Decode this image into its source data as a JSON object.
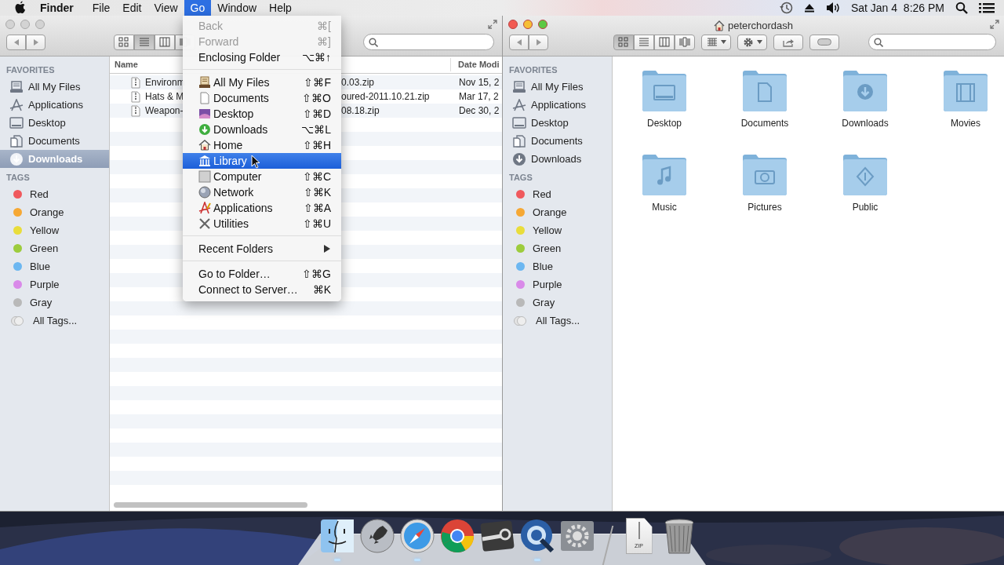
{
  "menu_bar": {
    "items": [
      {
        "label": "Finder",
        "kind": "app",
        "selected": false
      },
      {
        "label": "File",
        "kind": "menu",
        "selected": false
      },
      {
        "label": "Edit",
        "kind": "menu",
        "selected": false
      },
      {
        "label": "View",
        "kind": "menu",
        "selected": false
      },
      {
        "label": "Go",
        "kind": "menu",
        "selected": true
      },
      {
        "label": "Window",
        "kind": "menu",
        "selected": false
      },
      {
        "label": "Help",
        "kind": "menu",
        "selected": false
      }
    ],
    "clock": "Sat Jan 4  8:26 PM"
  },
  "go_menu": {
    "groups": [
      [
        {
          "label": "Back",
          "shortcut": "⌘[",
          "kind": "item",
          "disabled": true,
          "selected": false
        },
        {
          "label": "Forward",
          "shortcut": "⌘]",
          "kind": "item",
          "disabled": true,
          "selected": false
        },
        {
          "label": "Enclosing Folder",
          "shortcut": "⌥⌘↑",
          "kind": "item",
          "disabled": false,
          "selected": false
        }
      ],
      [
        {
          "label": "All My Files",
          "shortcut": "⇧⌘F",
          "kind": "files",
          "disabled": false,
          "selected": false
        },
        {
          "label": "Documents",
          "shortcut": "⇧⌘O",
          "kind": "documents",
          "disabled": false,
          "selected": false
        },
        {
          "label": "Desktop",
          "shortcut": "⇧⌘D",
          "kind": "desktop",
          "disabled": false,
          "selected": false
        },
        {
          "label": "Downloads",
          "shortcut": "⌥⌘L",
          "kind": "downloads",
          "disabled": false,
          "selected": false
        },
        {
          "label": "Home",
          "shortcut": "⇧⌘H",
          "kind": "home",
          "disabled": false,
          "selected": false
        },
        {
          "label": "Library",
          "kind": "library",
          "disabled": false,
          "selected": true
        },
        {
          "label": "Computer",
          "shortcut": "⇧⌘C",
          "kind": "computer",
          "disabled": false,
          "selected": false
        },
        {
          "label": "Network",
          "shortcut": "⇧⌘K",
          "kind": "network",
          "disabled": false,
          "selected": false
        },
        {
          "label": "Applications",
          "shortcut": "⇧⌘A",
          "kind": "applications",
          "disabled": false,
          "selected": false
        },
        {
          "label": "Utilities",
          "shortcut": "⇧⌘U",
          "kind": "utilities",
          "disabled": false,
          "selected": false
        }
      ],
      [
        {
          "label": "Recent Folders",
          "kind": "submenu",
          "disabled": false,
          "selected": false
        }
      ],
      [
        {
          "label": "Go to Folder…",
          "shortcut": "⇧⌘G",
          "kind": "item",
          "disabled": false,
          "selected": false
        },
        {
          "label": "Connect to Server…",
          "shortcut": "⌘K",
          "kind": "item",
          "disabled": false,
          "selected": false
        }
      ]
    ]
  },
  "left_window": {
    "active": false,
    "view_buttons": [
      {
        "kind": "icon",
        "selected": false
      },
      {
        "kind": "list",
        "selected": true
      },
      {
        "kind": "column",
        "selected": false
      },
      {
        "kind": "coverflow",
        "selected": false
      }
    ],
    "sidebar": {
      "sections": [
        {
          "heading": "FAVORITES",
          "items": [
            {
              "label": "All My Files",
              "kind": "files",
              "selected": false
            },
            {
              "label": "Applications",
              "kind": "applications",
              "selected": false
            },
            {
              "label": "Desktop",
              "kind": "desktop",
              "selected": false
            },
            {
              "label": "Documents",
              "kind": "documents",
              "selected": false
            },
            {
              "label": "Downloads",
              "kind": "downloads",
              "selected": true
            }
          ]
        },
        {
          "heading": "TAGS",
          "items": [
            {
              "label": "Red",
              "kind": "tag",
              "color": "#f0595d",
              "selected": false
            },
            {
              "label": "Orange",
              "kind": "tag",
              "color": "#f6a834",
              "selected": false
            },
            {
              "label": "Yellow",
              "kind": "tag",
              "color": "#e9dd3b",
              "selected": false
            },
            {
              "label": "Green",
              "kind": "tag",
              "color": "#9dcc3d",
              "selected": false
            },
            {
              "label": "Blue",
              "kind": "tag",
              "color": "#6cb7f1",
              "selected": false
            },
            {
              "label": "Purple",
              "kind": "tag",
              "color": "#d98ae9",
              "selected": false
            },
            {
              "label": "Gray",
              "kind": "tag",
              "color": "#b9b9b9",
              "selected": false
            },
            {
              "label": "All Tags...",
              "kind": "all",
              "selected": false
            }
          ]
        }
      ]
    },
    "file_list": {
      "columns": [
        "Name",
        "Date Modi"
      ],
      "rows": [
        {
          "name_start": "Environm",
          "name_end": "0.03.zip",
          "date": "Nov 15, 2"
        },
        {
          "name_start": "Hats & M",
          "name_end": "oured-2011.10.21.zip",
          "date": "Mar 17, 2"
        },
        {
          "name_start": "Weapon-",
          "name_end": "08.18.zip",
          "date": "Dec 30, 2"
        }
      ]
    }
  },
  "right_window": {
    "active": true,
    "title": "peterchordash",
    "view_buttons": [
      {
        "kind": "icon",
        "selected": true
      },
      {
        "kind": "list",
        "selected": false
      },
      {
        "kind": "column",
        "selected": false
      },
      {
        "kind": "coverflow",
        "selected": false
      }
    ],
    "sidebar": {
      "sections": [
        {
          "heading": "FAVORITES",
          "items": [
            {
              "label": "All My Files",
              "kind": "files",
              "selected": false
            },
            {
              "label": "Applications",
              "kind": "applications",
              "selected": false
            },
            {
              "label": "Desktop",
              "kind": "desktop",
              "selected": false
            },
            {
              "label": "Documents",
              "kind": "documents",
              "selected": false
            },
            {
              "label": "Downloads",
              "kind": "downloads",
              "selected": false
            }
          ]
        },
        {
          "heading": "TAGS",
          "items": [
            {
              "label": "Red",
              "kind": "tag",
              "color": "#f0595d",
              "selected": false
            },
            {
              "label": "Orange",
              "kind": "tag",
              "color": "#f6a834",
              "selected": false
            },
            {
              "label": "Yellow",
              "kind": "tag",
              "color": "#e9dd3b",
              "selected": false
            },
            {
              "label": "Green",
              "kind": "tag",
              "color": "#9dcc3d",
              "selected": false
            },
            {
              "label": "Blue",
              "kind": "tag",
              "color": "#6cb7f1",
              "selected": false
            },
            {
              "label": "Purple",
              "kind": "tag",
              "color": "#d98ae9",
              "selected": false
            },
            {
              "label": "Gray",
              "kind": "tag",
              "color": "#b9b9b9",
              "selected": false
            },
            {
              "label": "All Tags...",
              "kind": "all",
              "selected": false
            }
          ]
        }
      ]
    },
    "folders": [
      {
        "label": "Desktop",
        "kind": "desktop"
      },
      {
        "label": "Documents",
        "kind": "documents"
      },
      {
        "label": "Downloads",
        "kind": "downloads"
      },
      {
        "label": "Movies",
        "kind": "movies"
      },
      {
        "label": "Music",
        "kind": "music"
      },
      {
        "label": "Pictures",
        "kind": "pictures"
      },
      {
        "label": "Public",
        "kind": "public"
      }
    ]
  },
  "dock": {
    "apps": [
      {
        "kind": "finder",
        "running": true
      },
      {
        "kind": "rocket",
        "running": false
      },
      {
        "kind": "compass",
        "running": true
      },
      {
        "kind": "browser",
        "running": false
      },
      {
        "kind": "steam",
        "running": false
      },
      {
        "kind": "player",
        "running": true
      },
      {
        "kind": "gears",
        "running": false
      }
    ],
    "documents": [
      {
        "kind": "zip",
        "label": "ZIP"
      },
      {
        "kind": "trash"
      }
    ]
  }
}
